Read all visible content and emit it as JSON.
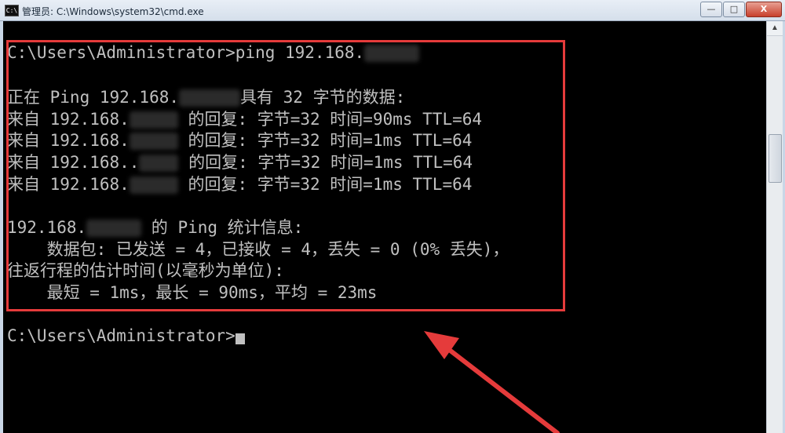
{
  "window": {
    "title": "管理员: C:\\Windows\\system32\\cmd.exe",
    "icon_text": "C:\\",
    "buttons": {
      "minimize": "—",
      "restore": "□",
      "close": "X"
    }
  },
  "console": {
    "lines": [
      {
        "before": "C:\\Users\\Administrator>ping 192.168.",
        "after": ""
      },
      {
        "before": "",
        "after": ""
      },
      {
        "before": "正在 Ping 192.168.",
        "after": "具有 32 字节的数据:"
      },
      {
        "before": "来自 192.168.",
        "after": " 的回复: 字节=32 时间=90ms TTL=64"
      },
      {
        "before": "来自 192.168.",
        "after": " 的回复: 字节=32 时间=1ms TTL=64"
      },
      {
        "before": "来自 192.168..",
        "after": " 的回复: 字节=32 时间=1ms TTL=64"
      },
      {
        "before": "来自 192.168.",
        "after": " 的回复: 字节=32 时间=1ms TTL=64"
      },
      {
        "before": "",
        "after": ""
      },
      {
        "before": "192.168.",
        "after": " 的 Ping 统计信息:"
      },
      {
        "before": "    数据包: 已发送 = 4，已接收 = 4，丢失 = 0 (0% 丢失)，",
        "after": ""
      },
      {
        "before": "往返行程的估计时间(以毫秒为单位):",
        "after": ""
      },
      {
        "before": "    最短 = 1ms，最长 = 90ms，平均 = 23ms",
        "after": ""
      },
      {
        "before": "",
        "after": ""
      },
      {
        "before": "C:\\Users\\Administrator>",
        "after": ""
      }
    ]
  },
  "colors": {
    "console_text": "#c0c0c0",
    "console_bg": "#000000",
    "annotation": "#e53b3b"
  }
}
